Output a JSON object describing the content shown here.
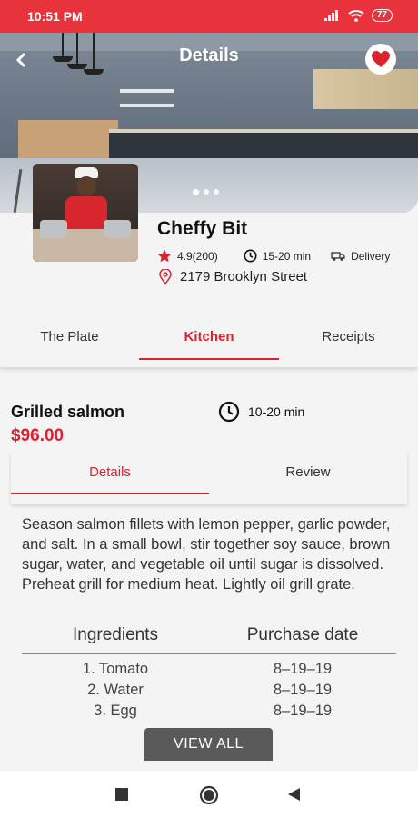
{
  "status": {
    "time": "10:51 PM",
    "battery": "77"
  },
  "header": {
    "title": "Details"
  },
  "restaurant": {
    "name": "Cheffy Bit",
    "rating": "4.9(200)",
    "time": "15-20 min",
    "service": "Delivery",
    "address": "2179 Brooklyn Street"
  },
  "tabs": [
    {
      "label": "The Plate"
    },
    {
      "label": "Kitchen"
    },
    {
      "label": "Receipts"
    }
  ],
  "dish": {
    "name": "Grilled salmon",
    "price": "$96.00",
    "time": "10-20 min"
  },
  "subtabs": [
    {
      "label": "Details"
    },
    {
      "label": "Review"
    }
  ],
  "description": "Season salmon fillets with lemon pepper, garlic powder, and salt. In a small bowl, stir together soy sauce, brown sugar, water, and vegetable oil until sugar is dissolved. Preheat grill for medium heat. Lightly oil grill grate.",
  "ingredients": {
    "headers": [
      "Ingredients",
      "Purchase date"
    ],
    "rows": [
      {
        "name": "1. Tomato",
        "date": "8–19–19"
      },
      {
        "name": "2. Water",
        "date": "8–19–19"
      },
      {
        "name": "3. Egg",
        "date": "8–19–19"
      }
    ]
  },
  "view_all_label": "VIEW ALL",
  "colors": {
    "accent": "#d7242e",
    "status_bar": "#e8323c"
  }
}
